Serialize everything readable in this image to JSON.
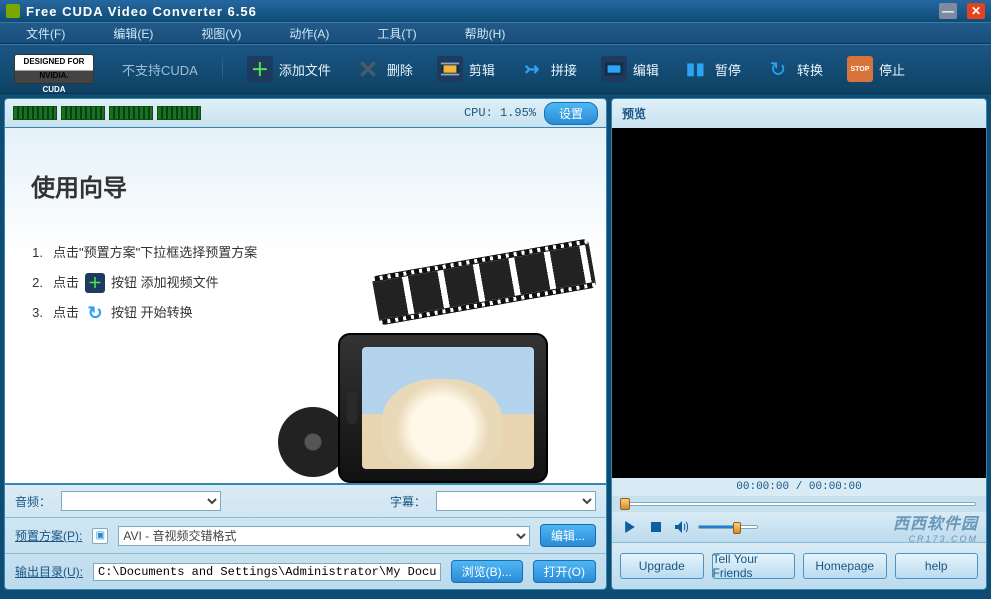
{
  "titlebar": {
    "title": "Free CUDA Video Converter 6.56"
  },
  "menu": {
    "file": "文件(F)",
    "edit": "编辑(E)",
    "view": "视图(V)",
    "action": "动作(A)",
    "tools": "工具(T)",
    "help": "帮助(H)"
  },
  "toolbar": {
    "cuda_status": "不支持CUDA",
    "nvidia_top": "DESIGNED FOR",
    "nvidia_mid": "NVIDIA.",
    "nvidia_bot": "CUDA",
    "add": "添加文件",
    "delete": "删除",
    "cut": "剪辑",
    "join": "拼接",
    "edit": "编辑",
    "pause": "暂停",
    "convert": "转换",
    "stop": "停止",
    "stop_icon_text": "STOP"
  },
  "cpu": {
    "label": "CPU: 1.95%",
    "settings_btn": "设置"
  },
  "wizard": {
    "title": "使用向导",
    "step1_prefix": "1. ",
    "step1_text": "点击\"预置方案\"下拉框选择预置方案",
    "step2_prefix": "2. ",
    "step2_a": "点击",
    "step2_b": "按钮 添加视频文件",
    "step3_prefix": "3. ",
    "step3_a": "点击",
    "step3_b": "按钮 开始转换"
  },
  "left_bottom": {
    "audio_label": "音频：",
    "subtitle_label": "字幕：",
    "preset_label": "预置方案(P):",
    "preset_value": "AVI - 音视频交错格式",
    "edit_btn": "编辑...",
    "output_label": "输出目录(U):",
    "output_value": "C:\\Documents and Settings\\Administrator\\My Docu",
    "browse_btn": "浏览(B)...",
    "open_btn": "打开(O)"
  },
  "preview": {
    "title": "预览",
    "time_text": "00:00:00 / 00:00:00",
    "watermark_a": "西西软件园",
    "watermark_b": "CR173.COM"
  },
  "footer": {
    "upgrade": "Upgrade",
    "tell": "Tell Your Friends",
    "homepage": "Homepage",
    "help": "help"
  }
}
